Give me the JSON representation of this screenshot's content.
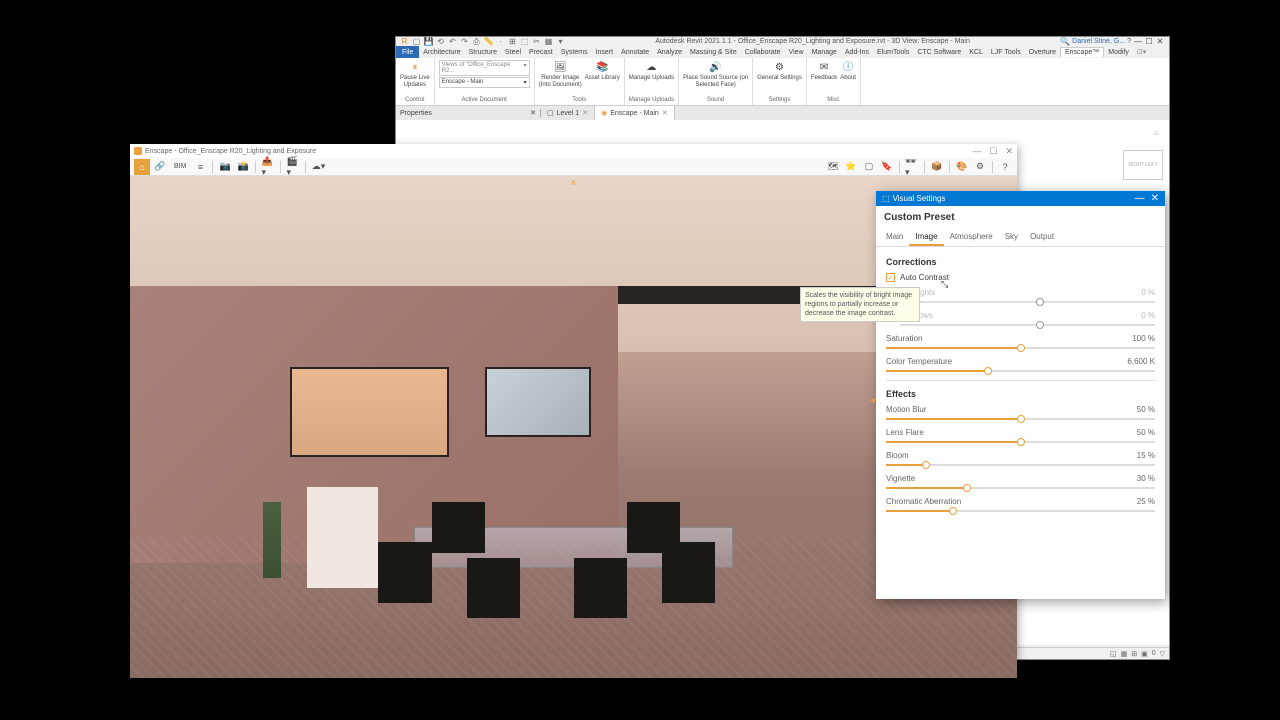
{
  "revit": {
    "title": "Autodesk Revit 2021.1.1 - Office_Enscape R20_Lighting and Exposure.rvt - 3D View: Enscape - Main",
    "user": "Daniel.Stine, G...",
    "menu": [
      "Architecture",
      "Structure",
      "Steel",
      "Precast",
      "Systems",
      "Insert",
      "Annotate",
      "Analyze",
      "Massing & Site",
      "Collaborate",
      "View",
      "Manage",
      "Add-Ins",
      "ElumTools",
      "CTC Software",
      "KCL",
      "LJF Tools",
      "Overture",
      "Enscape™",
      "Modify"
    ],
    "file": "File",
    "ribbon": {
      "g1": {
        "btn": "Pause Live\nUpdates",
        "label": "Control"
      },
      "g2": {
        "dd": "Views of \"Office_Enscape R2...",
        "btn": "Enscape - Main",
        "sub": "Active Document"
      },
      "g3": {
        "b1": "Render Image\n(Into Document)",
        "b2": "Asset Library",
        "label": "Tools"
      },
      "g4": {
        "btn": "Manage Uploads",
        "label": "Manage Uploads"
      },
      "g5": {
        "btn": "Place Sound Source (on\nSelected Face)",
        "label": "Sound"
      },
      "g6": {
        "btn": "General Settings",
        "label": "Settings"
      },
      "g7": {
        "b1": "Feedback",
        "b2": "About",
        "label": "Misc"
      }
    },
    "properties": "Properties",
    "tab1": "Level 1",
    "tab2": "Enscape - Main"
  },
  "enscape": {
    "title": "Enscape - Office_Enscape R20_Lighting and Exposure",
    "bim": "BIM"
  },
  "vs": {
    "title": "Visual Settings",
    "preset": "Custom Preset",
    "tabs": [
      "Main",
      "Image",
      "Atmosphere",
      "Sky",
      "Output"
    ],
    "corrections": "Corrections",
    "auto_contrast": "Auto Contrast",
    "highlights": {
      "label": "Highlights",
      "val": "0 %"
    },
    "shadows": {
      "label": "Shadows",
      "val": "0 %"
    },
    "saturation": {
      "label": "Saturation",
      "val": "100 %"
    },
    "color_temp": {
      "label": "Color Temperature",
      "val": "6,600 K"
    },
    "effects": "Effects",
    "motion_blur": {
      "label": "Motion Blur",
      "val": "50 %"
    },
    "lens_flare": {
      "label": "Lens Flare",
      "val": "50 %"
    },
    "bloom": {
      "label": "Bloom",
      "val": "15 %"
    },
    "vignette": {
      "label": "Vignette",
      "val": "30 %"
    },
    "chromatic": {
      "label": "Chromatic Aberration",
      "val": "25 %"
    }
  },
  "tooltip": "Scales the visibility of bright image regions to partially increase or decrease the image contrast."
}
